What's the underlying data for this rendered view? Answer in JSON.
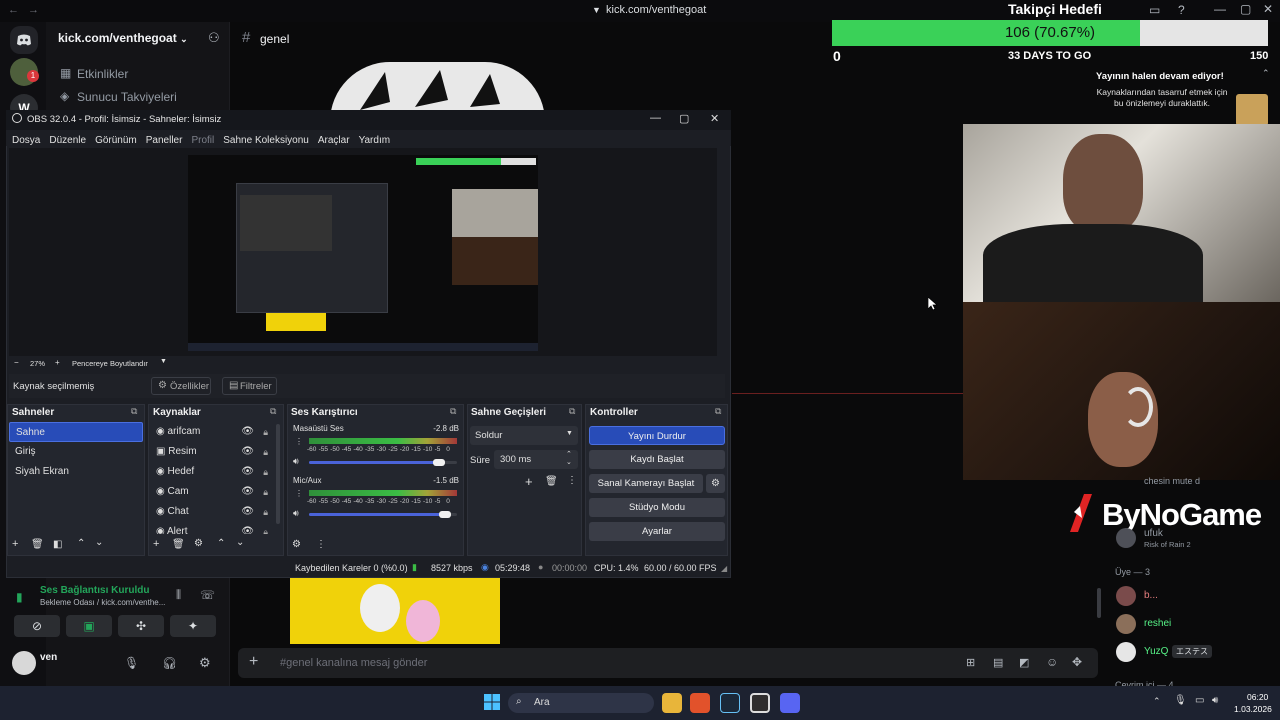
{
  "titlebar": {
    "url": "kick.com/venthegoat"
  },
  "server": {
    "name": "kick.com/venthegoat"
  },
  "channels": {
    "events": "Etkinlikler",
    "boosts": "Sunucu Takviyeleri"
  },
  "chat": {
    "channel": "genel",
    "message_placeholder": "#genel kanalına mesaj gönder"
  },
  "voice": {
    "status": "Ses Bağlantısı Kuruldu",
    "room": "Bekleme Odası / kick.com/venthe..."
  },
  "user": {
    "name": "ven"
  },
  "goal": {
    "title": "Takipçi Hedefi",
    "progress_text": "106 (70.67%)",
    "progress_fraction": 0.7067,
    "min": "0",
    "max": "150",
    "days_left": "33 DAYS TO GO"
  },
  "stream_paused": {
    "title": "Yayının halen devam ediyor!",
    "body": "Kaynaklarından tasarruf etmek için bu önizlemeyi duraklattık."
  },
  "branding": {
    "logo_text": "ByNoGame"
  },
  "obs": {
    "title": "OBS 32.0.4 - Profil: İsimsiz - Sahneler: İsimsiz",
    "menu": [
      "Dosya",
      "Düzenle",
      "Görünüm",
      "Paneller",
      "Profil",
      "Sahne Koleksiyonu",
      "Araçlar",
      "Yardım"
    ],
    "zoom": "27%",
    "fit_label": "Pencereye Boyutlandır",
    "no_source": "Kaynak seçilmemiş",
    "properties": "Özellikler",
    "filters": "Filtreler",
    "scenes_title": "Sahneler",
    "scenes": [
      "Sahne",
      "Giriş",
      "Siyah Ekran"
    ],
    "sources_title": "Kaynaklar",
    "sources": [
      "arifcam",
      "Resim",
      "Hedef",
      "Cam",
      "Chat",
      "Alert"
    ],
    "mixer_title": "Ses Karıştırıcı",
    "mixer": [
      {
        "name": "Masaüstü Ses",
        "db": "-2.8 dB",
        "level": 0.88
      },
      {
        "name": "Mic/Aux",
        "db": "-1.5 dB",
        "level": 0.92
      }
    ],
    "ticks": [
      "-60",
      "-55",
      "-50",
      "-45",
      "-40",
      "-35",
      "-30",
      "-25",
      "-20",
      "-15",
      "-10",
      "-5",
      "0"
    ],
    "transitions_title": "Sahne Geçişleri",
    "transition": "Soldur",
    "duration_label": "Süre",
    "duration": "300 ms",
    "controls_title": "Kontroller",
    "controls": [
      "Yayını Durdur",
      "Kaydı Başlat",
      "Sanal Kamerayı Başlat",
      "Stüdyo Modu",
      "Ayarlar"
    ],
    "status": {
      "dropped": "Kaybedilen Kareler 0 (%0.0)",
      "bitrate": "8527 kbps",
      "stream_time": "05:29:48",
      "rec_time": "00:00:00",
      "cpu": "CPU: 1.4%",
      "fps": "60.00 / 60.00 FPS"
    }
  },
  "members": {
    "partial1": "chesin mute d",
    "partial2": "ufuk",
    "partial2_game": "Risk of Rain 2",
    "group_label": "Üye — 3",
    "list": [
      {
        "name": "b...",
        "color": "#e67e7e"
      },
      {
        "name": "reshei",
        "color": "#57f287"
      },
      {
        "name": "YuzQ",
        "color": "#57f287",
        "tag": "エステス"
      }
    ],
    "online_label": "Çevrim içi — 4"
  },
  "taskbar": {
    "search": "Ara",
    "time": "06:20",
    "date": "1.03.2026"
  },
  "colors": {
    "accent": "#4a63d9",
    "goal_fill": "#3ad158",
    "green": "#57f287"
  }
}
